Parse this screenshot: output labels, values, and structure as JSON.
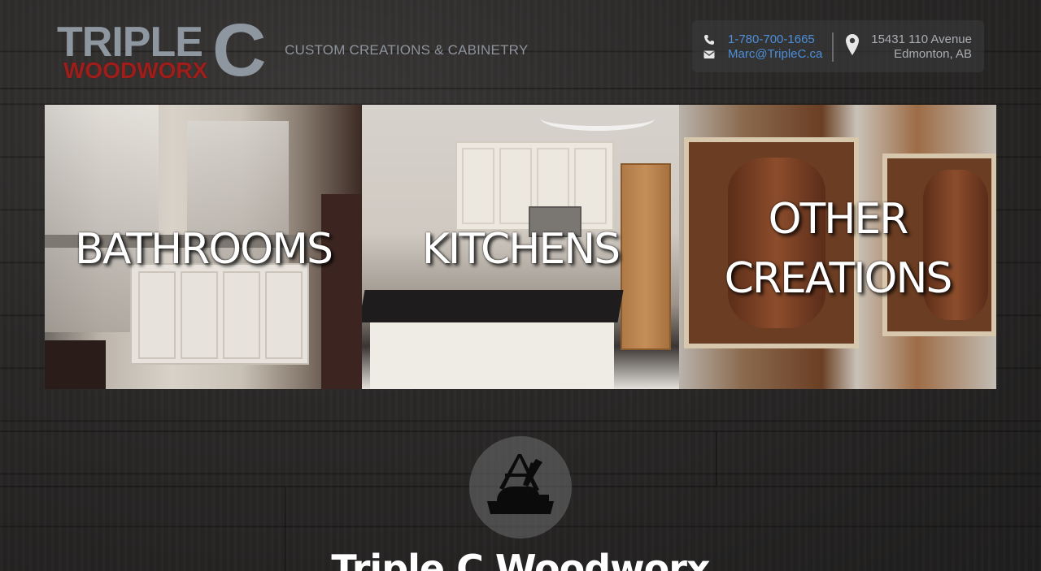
{
  "header": {
    "logo": {
      "line1": "TRIPLE",
      "letter": "C",
      "line2": "WOODWORX"
    },
    "tagline": "CUSTOM CREATIONS & CABINETRY",
    "contact": {
      "phone": "1-780-700-1665",
      "email": "Marc@TripleC.ca",
      "address_line1": "15431 110 Avenue",
      "address_line2": "Edmonton, AB",
      "phone_icon": "phone-icon",
      "email_icon": "envelope-icon",
      "address_icon": "map-pin-icon"
    }
  },
  "categories": [
    {
      "label": "BATHROOMS"
    },
    {
      "label": "KITCHENS"
    },
    {
      "label_line1": "OTHER",
      "label_line2": "CREATIONS"
    }
  ],
  "section": {
    "badge_icon": "woodworking-plane-icon",
    "title": "Triple C Woodworx"
  },
  "colors": {
    "link": "#4c8ed8",
    "logo_grey": "#8e96a0",
    "logo_red": "#9c1f1c",
    "background": "#2b2928"
  }
}
